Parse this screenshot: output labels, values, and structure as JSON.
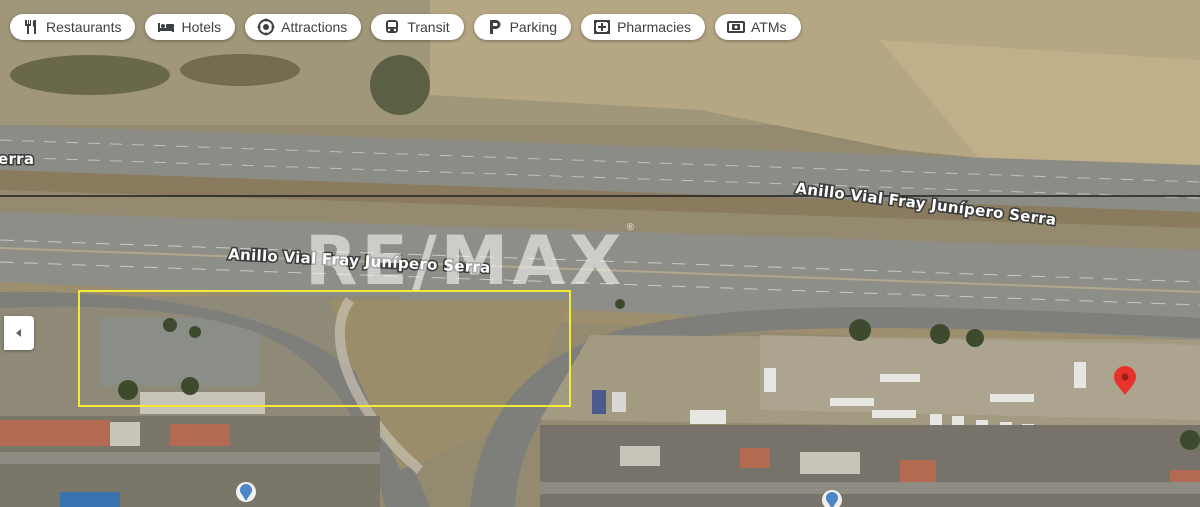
{
  "categories": [
    {
      "label": "Restaurants",
      "icon": "restaurant-icon"
    },
    {
      "label": "Hotels",
      "icon": "hotel-icon"
    },
    {
      "label": "Attractions",
      "icon": "camera-icon"
    },
    {
      "label": "Transit",
      "icon": "bus-icon"
    },
    {
      "label": "Parking",
      "icon": "parking-icon"
    },
    {
      "label": "Pharmacies",
      "icon": "pharmacy-icon"
    },
    {
      "label": "ATMs",
      "icon": "atm-icon"
    }
  ],
  "map": {
    "road_label_main": "Anillo Vial Fray Junípero Serra",
    "road_label_upper": "Anillo Vial Fray Junípero Serra",
    "road_label_fragment": "erra",
    "watermark": "RE/MAX",
    "watermark_reg": "®"
  },
  "colors": {
    "selection": "#f3ea3a",
    "pin": "#e8322c",
    "place_dot": "#4a86c8"
  }
}
